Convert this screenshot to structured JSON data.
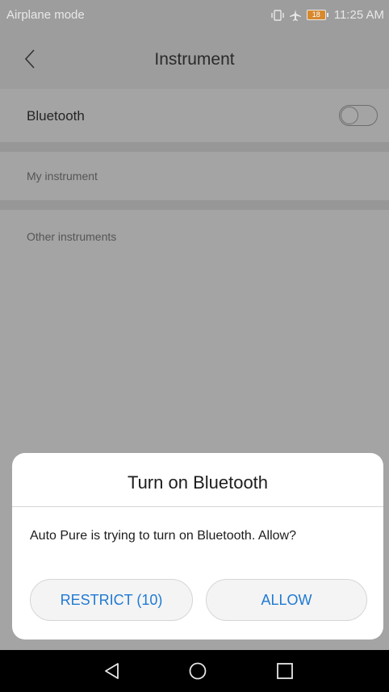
{
  "status_bar": {
    "left_text": "Airplane mode",
    "battery_level": "18",
    "time": "11:25 AM",
    "icons": [
      "vibrate-icon",
      "airplane-icon",
      "battery-icon"
    ]
  },
  "header": {
    "title": "Instrument",
    "back_icon": "chevron-left-icon"
  },
  "settings": {
    "bluetooth_label": "Bluetooth",
    "bluetooth_enabled": false,
    "my_instrument_label": "My instrument",
    "other_instruments_label": "Other instruments"
  },
  "dialog": {
    "title": "Turn on Bluetooth",
    "message": "Auto Pure is trying to turn on Bluetooth. Allow?",
    "restrict_label": "RESTRICT (10)",
    "allow_label": "ALLOW",
    "accent_color": "#1f7ad3"
  },
  "nav_bar": {
    "icons": [
      "back-triangle-icon",
      "home-circle-icon",
      "recents-square-icon"
    ]
  }
}
